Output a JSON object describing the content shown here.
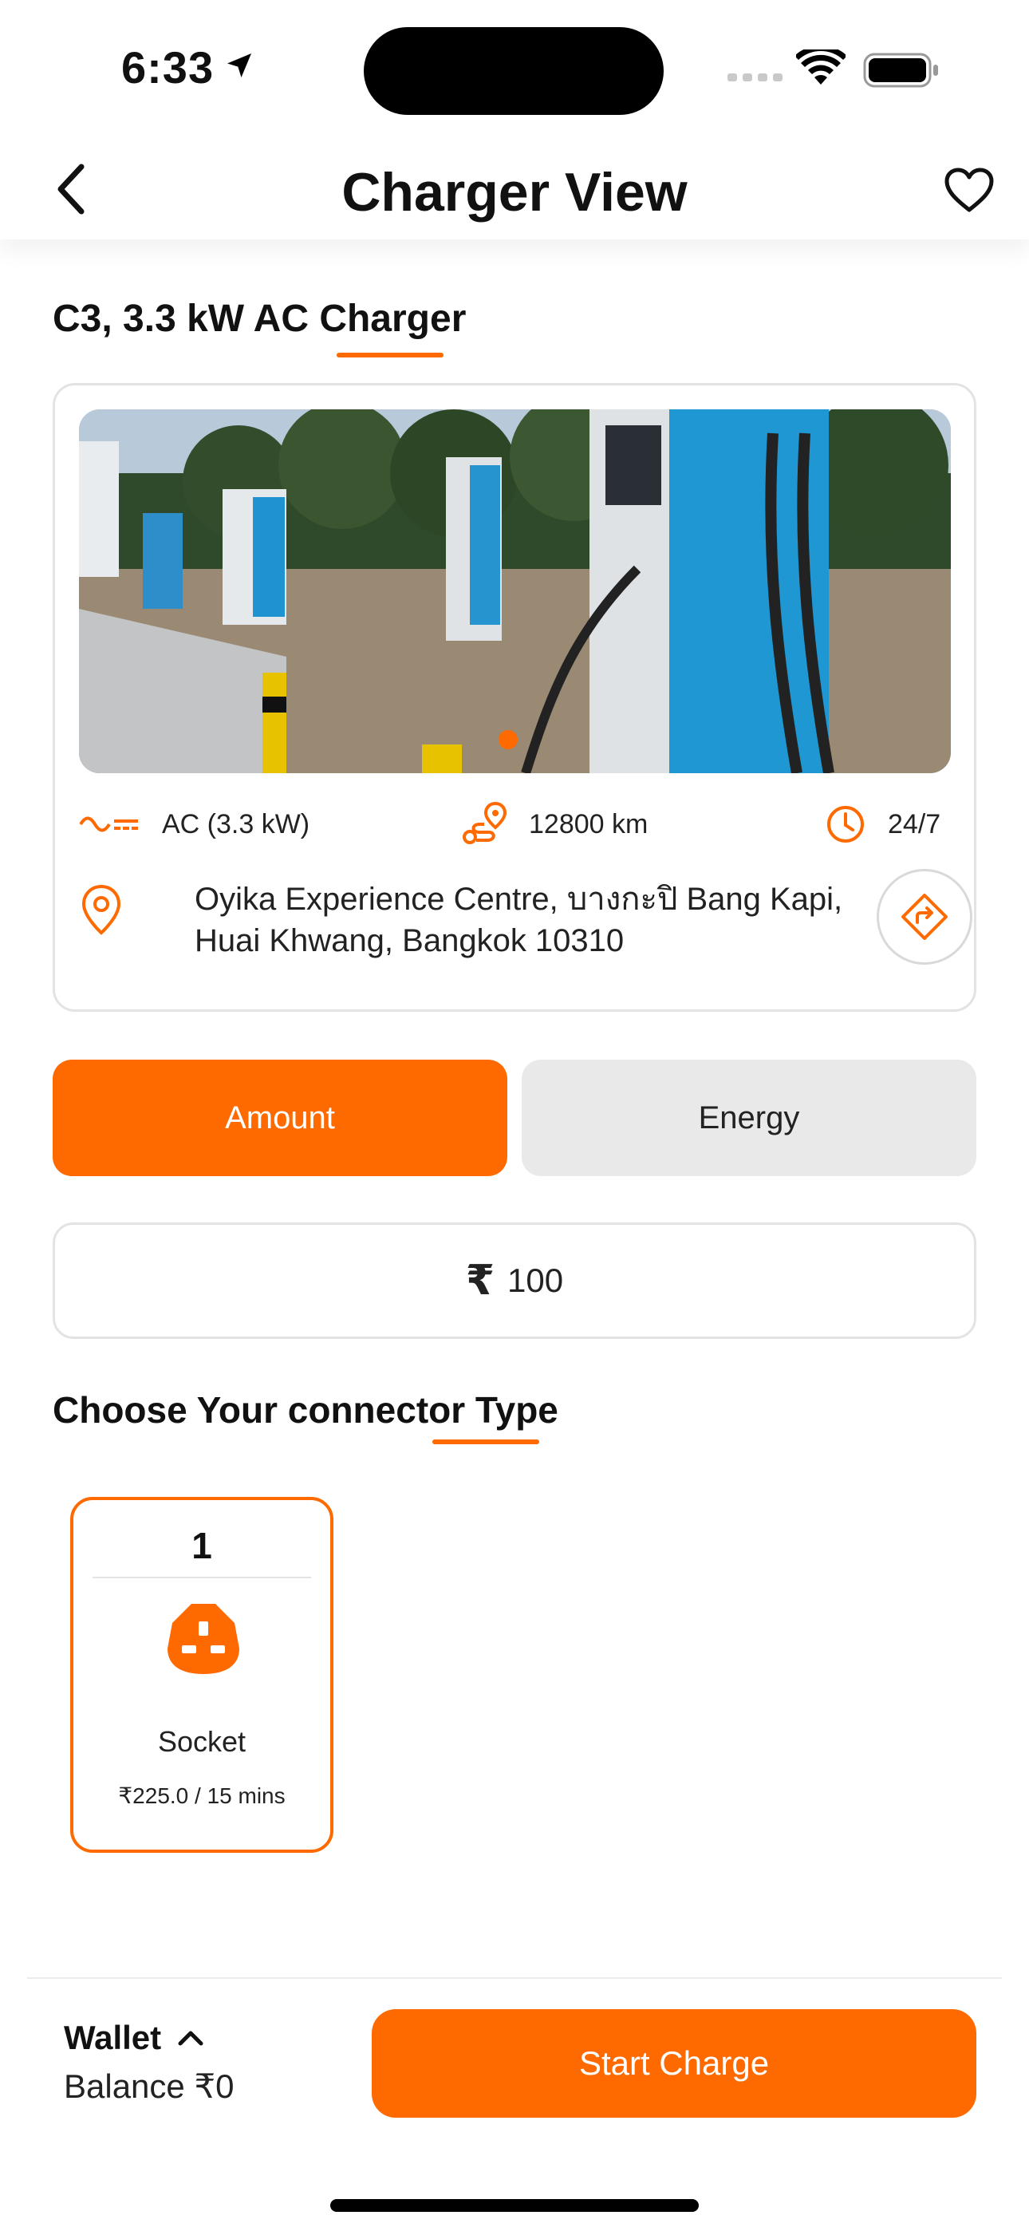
{
  "status": {
    "time": "6:33"
  },
  "header": {
    "title": "Charger View",
    "back_icon": "chevron-left-icon",
    "favorite_icon": "heart-icon"
  },
  "charger": {
    "name": "C3, 3.3 kW AC Charger",
    "power": "AC (3.3 kW)",
    "distance": "12800 km",
    "hours": "24/7",
    "address": "Oyika Experience Centre, บางกะปิ Bang Kapi, Huai Khwang, Bangkok 10310"
  },
  "mode": {
    "amount_label": "Amount",
    "energy_label": "Energy",
    "selected": "Amount"
  },
  "amount_input": {
    "currency": "₹",
    "value": "100"
  },
  "connector_section": {
    "title": "Choose Your connector Type",
    "connectors": [
      {
        "number": "1",
        "name": "Socket",
        "price": "₹225.0 / 15 mins",
        "icon": "socket-plug-icon"
      }
    ]
  },
  "footer": {
    "wallet_label": "Wallet",
    "balance_label": "Balance",
    "balance_value": "₹0",
    "start_label": "Start Charge"
  },
  "colors": {
    "accent": "#FF6A00",
    "inactive": "#E9E9E9",
    "border": "#E3E3E3"
  }
}
